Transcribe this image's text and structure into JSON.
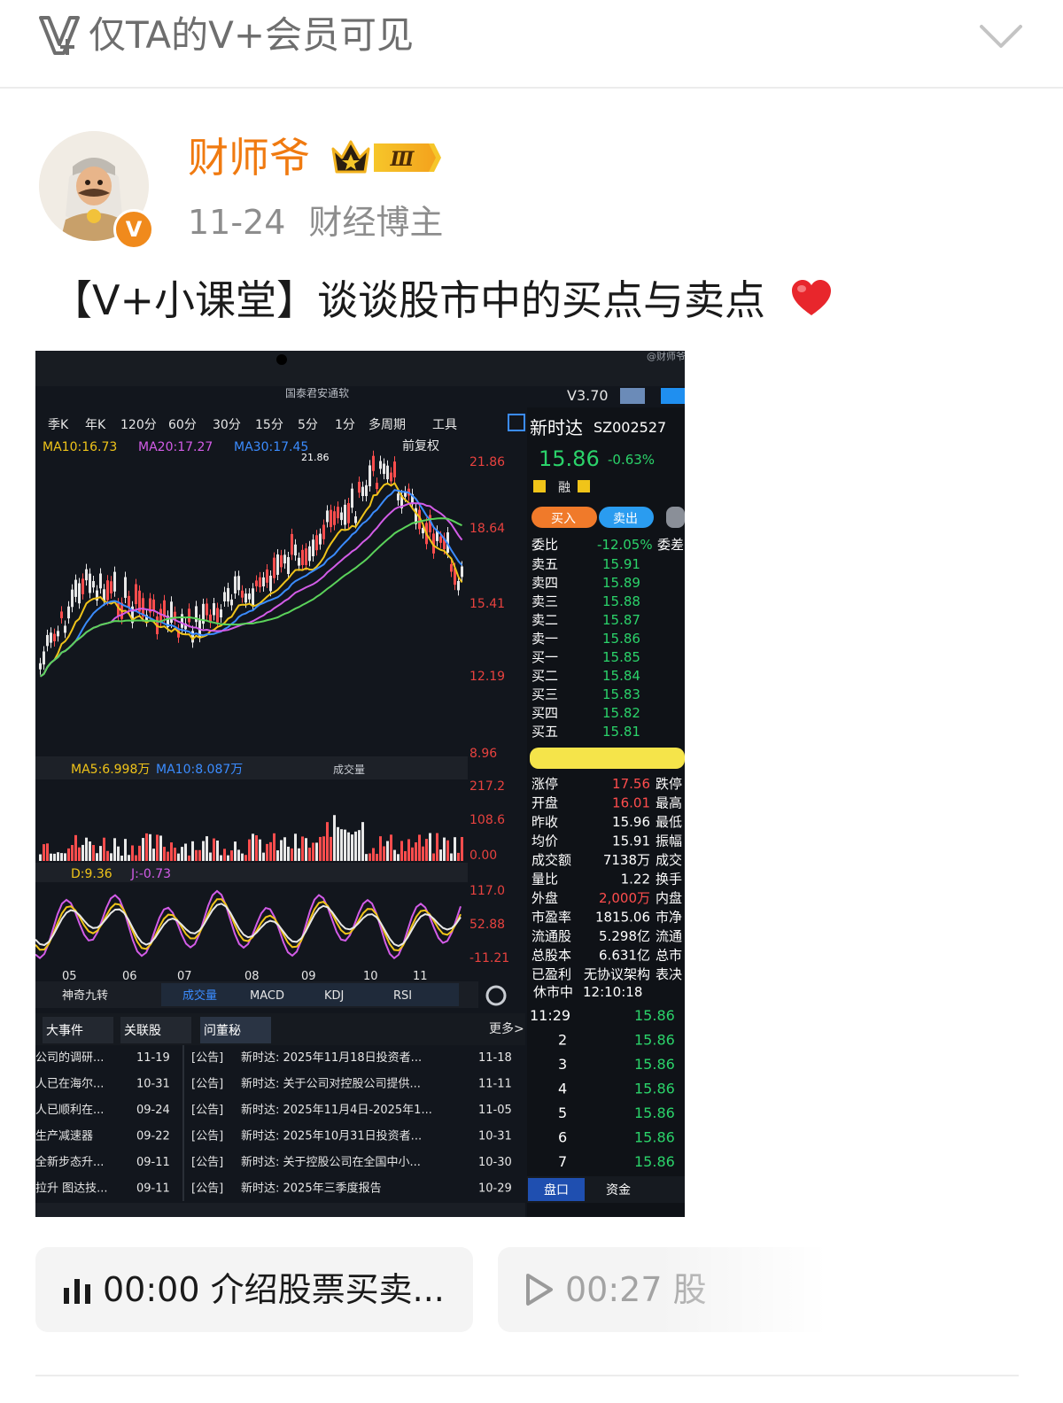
{
  "header": {
    "visibility_text": "仅TA的V+会员可见",
    "logo_icon": "v-plus-logo-icon",
    "collapse_icon": "chevron-down-icon"
  },
  "author": {
    "name": "财师爷",
    "level": "Ⅲ",
    "verified_badge": "V",
    "date": "11-24",
    "tag": "财经博主"
  },
  "post": {
    "text": "【V+小课堂】谈谈股市中的买点与卖点",
    "emoji": "red-heart-icon"
  },
  "screenshot": {
    "watermark": "@财师爷",
    "app_title": "国泰君安通软",
    "version": "V3.70",
    "periods": [
      "季K",
      "年K",
      "120分",
      "60分",
      "30分",
      "15分",
      "5分",
      "1分",
      "多周期",
      "工具"
    ],
    "ma": [
      {
        "label": "MA10:16.73",
        "color": "#f0c419"
      },
      {
        "label": "MA20:17.27",
        "color": "#d35ce8"
      },
      {
        "label": "MA30:17.45",
        "color": "#3b8cff"
      }
    ],
    "adjust": "前复权",
    "price_axis": [
      "21.86",
      "18.64",
      "15.41",
      "12.19",
      "8.96"
    ],
    "peak": "21.86",
    "vol_ma": [
      {
        "label": "MA5:6.998万",
        "color": "#f0c419"
      },
      {
        "label": "MA10:8.087万",
        "color": "#3b8cff"
      }
    ],
    "vol_label": "成交量",
    "vol_axis": [
      "217.2",
      "108.6",
      "0.00"
    ],
    "kdj_labels": [
      "D:9.36",
      "J:-0.73"
    ],
    "kdj_axis": [
      "117.0",
      "52.88",
      "-11.21"
    ],
    "months": [
      "05",
      "06",
      "07",
      "08",
      "09",
      "10",
      "11"
    ],
    "indicator_tabs": [
      "神奇九转",
      "成交量",
      "MACD",
      "KDJ",
      "RSI"
    ],
    "stock_name": "新时达",
    "stock_code": "SZ002527",
    "price": "15.86",
    "change": "-0.63%",
    "rong": "融",
    "buy_btn": "买入",
    "sell_btn": "卖出",
    "weibi_label": "委比",
    "weibi_value": "-12.05%",
    "weicha_label": "委差",
    "book": [
      {
        "label": "卖五",
        "price": "15.91"
      },
      {
        "label": "卖四",
        "price": "15.89"
      },
      {
        "label": "卖三",
        "price": "15.88"
      },
      {
        "label": "卖二",
        "price": "15.87"
      },
      {
        "label": "卖一",
        "price": "15.86"
      },
      {
        "label": "买一",
        "price": "15.85"
      },
      {
        "label": "买二",
        "price": "15.84"
      },
      {
        "label": "买三",
        "price": "15.83"
      },
      {
        "label": "买四",
        "price": "15.82"
      },
      {
        "label": "买五",
        "price": "15.81"
      }
    ],
    "stats": [
      {
        "label": "涨停",
        "value": "17.56",
        "right": "跌停"
      },
      {
        "label": "开盘",
        "value": "16.01",
        "right": "最高"
      },
      {
        "label": "昨收",
        "value": "15.96",
        "right": "最低"
      },
      {
        "label": "均价",
        "value": "15.91",
        "right": "振幅"
      },
      {
        "label": "成交额",
        "value": "7138万",
        "right": "成交"
      },
      {
        "label": "量比",
        "value": "1.22",
        "right": "换手"
      },
      {
        "label": "外盘",
        "value": "2,000万",
        "right": "内盘"
      },
      {
        "label": "市盈率",
        "value": "1815.06",
        "right": "市净"
      },
      {
        "label": "流通股",
        "value": "5.298亿",
        "right": "流通"
      },
      {
        "label": "总股本",
        "value": "6.631亿",
        "right": "总市"
      },
      {
        "label": "已盈利",
        "value": "无协议架构",
        "right": "表决"
      }
    ],
    "status": "休市中",
    "status_time": "12:10:18",
    "ticks": [
      {
        "t": "11:29",
        "p": "15.86"
      },
      {
        "t": "2",
        "p": "15.86"
      },
      {
        "t": "3",
        "p": "15.86"
      },
      {
        "t": "4",
        "p": "15.86"
      },
      {
        "t": "5",
        "p": "15.86"
      },
      {
        "t": "6",
        "p": "15.86"
      },
      {
        "t": "7",
        "p": "15.86"
      }
    ],
    "bottom_right_tabs": [
      "盘口",
      "资金"
    ],
    "news_tabs": [
      "大事件",
      "关联股",
      "问董秘"
    ],
    "news_more": "更多>",
    "news_left": [
      {
        "t": "公司的调研...",
        "d": "11-19"
      },
      {
        "t": "人已在海尔...",
        "d": "10-31"
      },
      {
        "t": "人已顺利在...",
        "d": "09-24"
      },
      {
        "t": "生产减速器",
        "d": "09-22"
      },
      {
        "t": "全新步态升...",
        "d": "09-11"
      },
      {
        "t": "拉升 图达技...",
        "d": "09-11"
      }
    ],
    "news_right": [
      {
        "tag": "[公告]",
        "t": "新时达: 2025年11月18日投资者...",
        "d": "11-18"
      },
      {
        "tag": "[公告]",
        "t": "新时达: 关于公司对控股公司提供...",
        "d": "11-11"
      },
      {
        "tag": "[公告]",
        "t": "新时达: 2025年11月4日-2025年1...",
        "d": "11-05"
      },
      {
        "tag": "[公告]",
        "t": "新时达: 2025年10月31日投资者...",
        "d": "10-31"
      },
      {
        "tag": "[公告]",
        "t": "新时达: 关于控股公司在全国中小...",
        "d": "10-30"
      },
      {
        "tag": "[公告]",
        "t": "新时达: 2025年三季度报告",
        "d": "10-29"
      }
    ]
  },
  "audio": [
    {
      "icon": "audio-bars-icon",
      "time": "00:00",
      "title": "介绍股票买卖..."
    },
    {
      "icon": "play-icon",
      "time": "00:27",
      "title": "股"
    }
  ]
}
